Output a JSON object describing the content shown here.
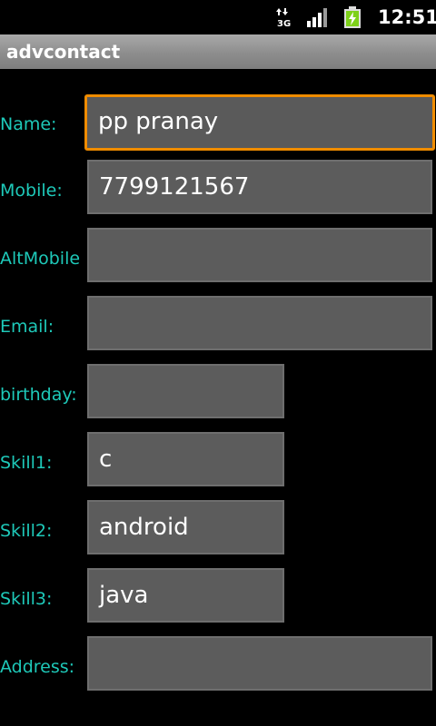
{
  "status_bar": {
    "network_icon": "3g-data-icon",
    "network_label": "3G",
    "signal_icon": "signal-bars-icon",
    "battery_icon": "battery-charging-icon",
    "time": "12:51"
  },
  "app": {
    "title": "advcontact"
  },
  "form": {
    "name": {
      "label": "Name:",
      "value": "pp pranay"
    },
    "mobile": {
      "label": "Mobile:",
      "value": "7799121567"
    },
    "altmobile": {
      "label": "AltMobile",
      "value": ""
    },
    "email": {
      "label": "Email:",
      "value": ""
    },
    "birthday": {
      "label": "birthday:",
      "value": ""
    },
    "skill1": {
      "label": "Skill1:",
      "value": "c"
    },
    "skill2": {
      "label": "Skill2:",
      "value": "android"
    },
    "skill3": {
      "label": "Skill3:",
      "value": "java"
    },
    "address": {
      "label": "Address:",
      "value": ""
    }
  },
  "colors": {
    "label": "#1ec9b9",
    "field_bg": "#5c5c5c",
    "focus_border": "#f08c00",
    "title_bar": "#8d8d8d"
  }
}
